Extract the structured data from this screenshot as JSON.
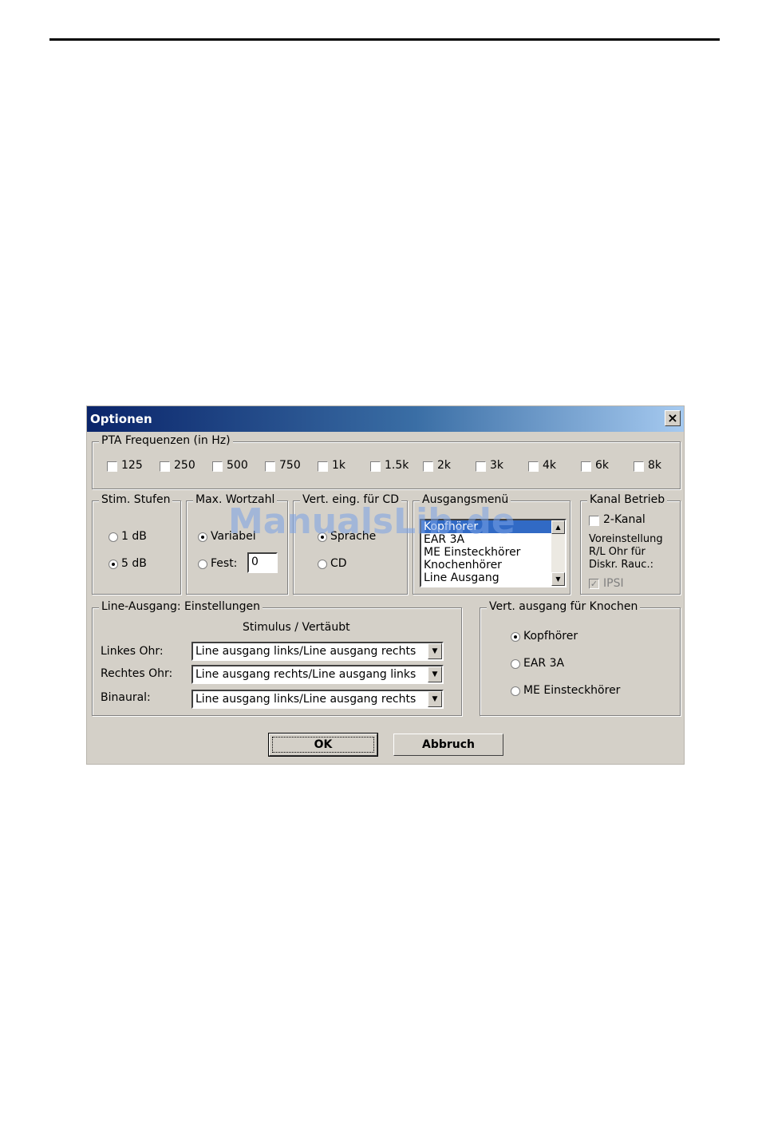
{
  "dialog": {
    "title": "Optionen",
    "close_glyph": "×"
  },
  "pta": {
    "legend": "PTA Frequenzen (in Hz)",
    "frequencies": [
      "125",
      "250",
      "500",
      "750",
      "1k",
      "1.5k",
      "2k",
      "3k",
      "4k",
      "6k",
      "8k"
    ]
  },
  "stim": {
    "legend": "Stim. Stufen",
    "opt1": "1 dB",
    "opt2": "5 dB",
    "selected": "5 dB"
  },
  "wortzahl": {
    "legend": "Max. Wortzahl",
    "variabel": "Variabel",
    "fest": "Fest:",
    "fest_value": "0"
  },
  "vert_cd": {
    "legend": "Vert. eing. für CD",
    "opt1": "Sprache",
    "opt2": "CD"
  },
  "ausgang": {
    "legend": "Ausgangsmenü",
    "items": [
      "Kopfhörer",
      "EAR 3A",
      "ME Einsteckhörer",
      "Knochenhörer",
      "Line Ausgang"
    ],
    "selected": "Kopfhörer"
  },
  "kanal": {
    "legend": "Kanal Betrieb",
    "two_channel": "2-Kanal",
    "voreinstellung_line1": "Voreinstellung",
    "voreinstellung_line2": "R/L Ohr für",
    "voreinstellung_line3": "Diskr. Rauc.:",
    "ipsi": "IPSI"
  },
  "line": {
    "legend": "Line-Ausgang: Einstellungen",
    "header": "Stimulus / Vertäubt",
    "links_label": "Linkes Ohr:",
    "links_value": "Line ausgang links/Line ausgang rechts",
    "rechts_label": "Rechtes Ohr:",
    "rechts_value": "Line ausgang rechts/Line ausgang links",
    "binaural_label": "Binaural:",
    "binaural_value": "Line ausgang links/Line ausgang rechts"
  },
  "knochen": {
    "legend": "Vert. ausgang für Knochen",
    "opt1": "Kopfhörer",
    "opt2": "EAR 3A",
    "opt3": "ME Einsteckhörer"
  },
  "buttons": {
    "ok": "OK",
    "cancel": "Abbruch"
  },
  "watermark": "ManualsLib.de"
}
